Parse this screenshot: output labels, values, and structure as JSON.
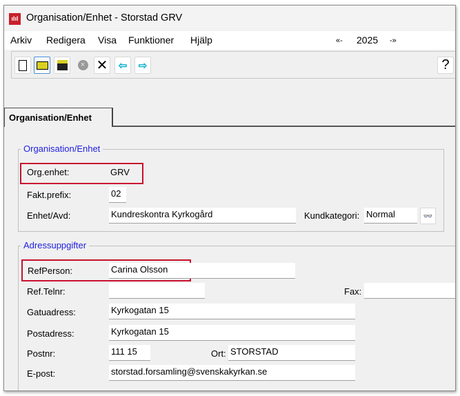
{
  "window": {
    "title": "Organisation/Enhet - Storstad GRV",
    "app_icon": "chart-bars-icon"
  },
  "menu": {
    "items": [
      "Arkiv",
      "Redigera",
      "Visa",
      "Funktioner",
      "Hjälp"
    ],
    "prev_year": "«-",
    "year": "2025",
    "next_year": "-»"
  },
  "toolbar": {
    "buttons": [
      "new-document-icon",
      "open-folder-icon",
      "save-disk-icon",
      "cancel-circle-icon",
      "delete-x-icon",
      "arrow-left-icon",
      "arrow-right-icon"
    ],
    "help": "?"
  },
  "tabs": [
    {
      "label": "Organisation/Enhet",
      "active": true
    }
  ],
  "org_group": {
    "legend": "Organisation/Enhet",
    "org_enhet_label": "Org.enhet:",
    "org_enhet_value": "GRV",
    "fakt_prefix_label": "Fakt.prefix:",
    "fakt_prefix_value": "02",
    "enhet_avd_label": "Enhet/Avd:",
    "enhet_avd_value": "Kundreskontra Kyrkogård",
    "kundkategori_label": "Kundkategori:",
    "kundkategori_value": "Normal"
  },
  "address_group": {
    "legend": "Adressuppgifter",
    "refperson_label": "RefPerson:",
    "refperson_value": "Carina Olsson",
    "ref_telnr_label": "Ref.Telnr:",
    "ref_telnr_value": "",
    "fax_label": "Fax:",
    "fax_value": "",
    "gatuadress_label": "Gatuadress:",
    "gatuadress_value": "Kyrkogatan 15",
    "postadress_label": "Postadress:",
    "postadress_value": "Kyrkogatan 15",
    "postnr_label": "Postnr:",
    "postnr_value": "111 15",
    "ort_label": "Ort:",
    "ort_value": "STORSTAD",
    "epost_label": "E-post:",
    "epost_value": "storstad.forsamling@svenskakyrkan.se"
  },
  "highlight_color": "#c8102e"
}
